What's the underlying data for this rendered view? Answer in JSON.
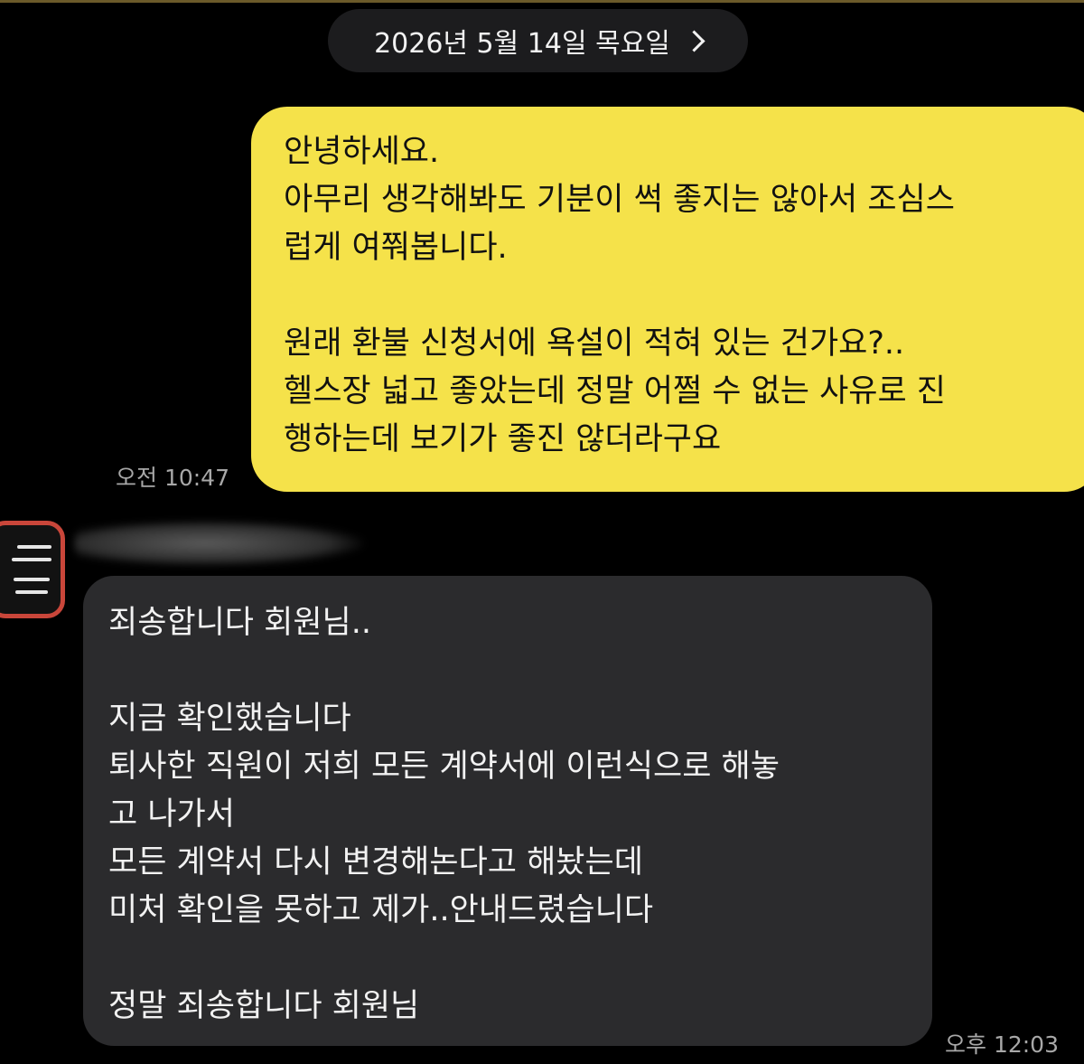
{
  "date_header": {
    "label": "2026년 5월 14일 목요일",
    "icon": "chevron-right-icon"
  },
  "messages": [
    {
      "sender": "me",
      "bubble_color": "#f5e24a",
      "lines": [
        "안녕하세요.",
        "아무리 생각해봐도 기분이 썩 좋지는 않아서 조심스",
        "럽게 여쭤봅니다.",
        "",
        "원래 환불 신청서에 욕설이 적혀 있는 건가요?..",
        "헬스장 넓고 좋았는데 정말 어쩔 수 없는 사유로 진",
        "행하는데 보기가 좋진 않더라구요"
      ],
      "time": "오전 10:47"
    },
    {
      "sender": "other",
      "bubble_color": "#2b2b2d",
      "lines": [
        "죄송합니다 회원님..",
        "",
        "지금 확인했습니다",
        "퇴사한 직원이 저희 모든 계약서에 이런식으로 해놓",
        "고 나가서",
        "모든 계약서 다시 변경해논다고 해놨는데",
        "미처 확인을 못하고 제가..안내드렸습니다",
        "",
        "정말 죄송합니다 회원님"
      ],
      "time": "오후 12:03"
    }
  ],
  "colors": {
    "background": "#000000",
    "my_bubble": "#f5e24a",
    "their_bubble": "#2b2b2d",
    "avatar_border": "#c9463a"
  }
}
